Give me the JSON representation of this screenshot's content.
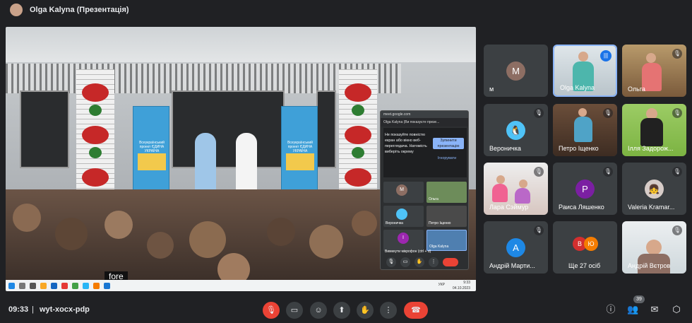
{
  "window": {
    "presenter_title": "Olga Kalyna (Презентація)"
  },
  "presentation": {
    "caption": "fore",
    "banner_text": "Всеукраїнський проект ЄДИНА УКРАЇНА",
    "taskbar_lang": "УКР",
    "taskbar_time": "9:33",
    "taskbar_date": "04.10.2023"
  },
  "mini_window": {
    "url": "meet.google.com",
    "title": "Olga Kalyna (Ви показуєте презе...",
    "warning": "Не показуйте повністю екран або вікно веб-переглядача. Натомість виберіть окрему",
    "stop_label": "Зупинити презентацію",
    "ignore_label": "Ігнорувати",
    "tiles": [
      {
        "name": "М",
        "label": ""
      },
      {
        "name": "Ольга",
        "label": "Ольга"
      },
      {
        "name": "Вероничка",
        "label": "Вероничка"
      },
      {
        "name": "Петро Іщенко",
        "label": "Петро Іщенко"
      },
      {
        "name": "І",
        "label": ""
      },
      {
        "name": "Olga Kalyna",
        "label": "Olga Kalyna"
      }
    ],
    "mute_hint": "Вимкнути мікрофон (ctrl + d)"
  },
  "participants": [
    {
      "name": "м",
      "avatar_letter": "М",
      "avatar_color": "#8d6e63",
      "muted": false,
      "video": false
    },
    {
      "name": "Olga Kalyna",
      "avatar_letter": "",
      "muted": false,
      "speaking": true,
      "video": true
    },
    {
      "name": "Ольга",
      "avatar_letter": "",
      "muted": true,
      "video": true
    },
    {
      "name": "Вероничка",
      "avatar_letter": "",
      "muted": true,
      "video": false
    },
    {
      "name": "Петро Іщенко",
      "avatar_letter": "",
      "muted": true,
      "video": true
    },
    {
      "name": "Ілля Задорож...",
      "avatar_letter": "",
      "muted": true,
      "video": true
    },
    {
      "name": "Лара Сэймур",
      "avatar_letter": "",
      "muted": true,
      "video": true
    },
    {
      "name": "Раиса Ляшенко",
      "avatar_letter": "Р",
      "avatar_color": "#7b1fa2",
      "muted": true,
      "video": false
    },
    {
      "name": "Valeria Kramar...",
      "avatar_letter": "",
      "muted": true,
      "video": false
    },
    {
      "name": "Андрій Марти...",
      "avatar_letter": "А",
      "avatar_color": "#1e88e5",
      "muted": true,
      "video": false
    },
    {
      "name": "Ще 27 осіб",
      "avatar_letter": "",
      "muted": true,
      "video": false,
      "others": [
        "В",
        "Ю"
      ]
    },
    {
      "name": "Андрій Вєтров",
      "avatar_letter": "",
      "muted": true,
      "video": true
    }
  ],
  "bottom_bar": {
    "time": "09:33",
    "separator": "|",
    "meeting_code": "wyt-xocx-pdp",
    "participant_count": "39"
  },
  "colors": {
    "background": "#202124",
    "tile": "#3c4043",
    "danger": "#ea4335",
    "accent": "#8ab4f8"
  }
}
